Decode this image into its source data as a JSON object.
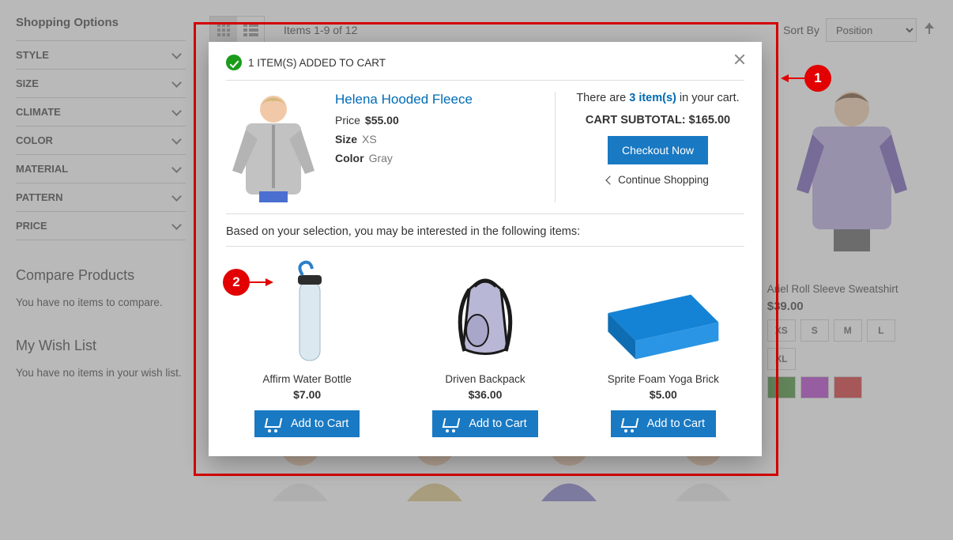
{
  "sidebar": {
    "title": "Shopping Options",
    "filters": [
      "STYLE",
      "SIZE",
      "CLIMATE",
      "COLOR",
      "MATERIAL",
      "PATTERN",
      "PRICE"
    ],
    "compare": {
      "title": "Compare Products",
      "empty": "You have no items to compare."
    },
    "wishlist": {
      "title": "My Wish List",
      "empty": "You have no items in your wish list."
    }
  },
  "toolbar": {
    "items_text": "Items 1-9 of 12",
    "sort_label": "Sort By",
    "sort_value": "Position"
  },
  "product_visible": {
    "name": "Ariel Roll Sleeve Sweatshirt",
    "price": "$39.00",
    "sizes": [
      "XS",
      "S",
      "M",
      "L",
      "XL"
    ],
    "colors": [
      "#3c8a2e",
      "#b233c9",
      "#d62828"
    ]
  },
  "modal": {
    "header": "1 ITEM(S) ADDED TO CART",
    "product": {
      "name": "Helena Hooded Fleece",
      "price_label": "Price",
      "price_value": "$55.00",
      "size_label": "Size",
      "size_value": "XS",
      "color_label": "Color",
      "color_value": "Gray"
    },
    "cart": {
      "prefix": "There are ",
      "count_text": "3 item(s)",
      "suffix": " in your cart.",
      "subtotal_label": "CART SUBTOTAL: ",
      "subtotal_value": "$165.00",
      "checkout_label": "Checkout Now",
      "continue_label": "Continue Shopping"
    },
    "reco_head": "Based on your selection, you may be interested in the following items:",
    "recos": [
      {
        "name": "Affirm Water Bottle",
        "price": "$7.00",
        "cta": "Add to Cart"
      },
      {
        "name": "Driven Backpack",
        "price": "$36.00",
        "cta": "Add to Cart"
      },
      {
        "name": "Sprite Foam Yoga Brick",
        "price": "$5.00",
        "cta": "Add to Cart"
      }
    ]
  },
  "callouts": {
    "one": "1",
    "two": "2"
  }
}
